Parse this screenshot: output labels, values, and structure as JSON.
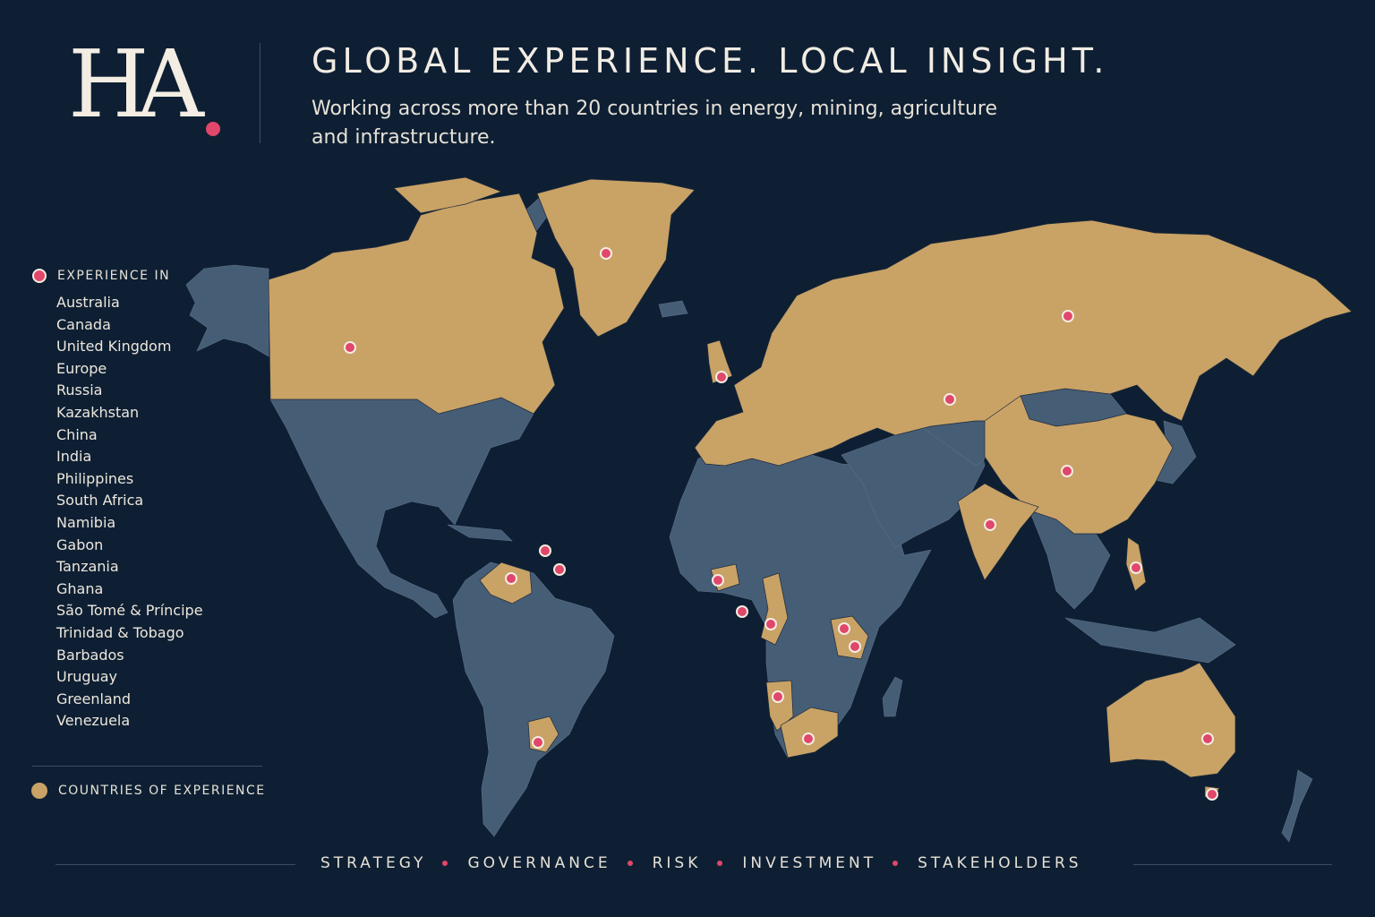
{
  "brand": {
    "logo_text": "HA",
    "accent_color": "#e0476a"
  },
  "header": {
    "title": "GLOBAL EXPERIENCE. LOCAL INSIGHT.",
    "subtitle_line1": "Working across more than 20 countries in energy, mining, agriculture",
    "subtitle_line2": "and infrastructure."
  },
  "legend": {
    "pins_label": "EXPERIENCE IN",
    "countries": [
      "Australia",
      "Canada",
      "United Kingdom",
      "Europe",
      "Russia",
      "Kazakhstan",
      "China",
      "India",
      "Philippines",
      "South Africa",
      "Namibia",
      "Gabon",
      "Tanzania",
      "Ghana",
      "São Tomé & Príncipe",
      "Trinidad & Tobago",
      "Barbados",
      "Uruguay",
      "Greenland",
      "Venezuela"
    ],
    "area_label": "COUNTRIES OF EXPERIENCE"
  },
  "colors": {
    "background": "#0e1f33",
    "experience_land": "#c9a266",
    "other_land": "#465d76",
    "pin": "#e0476a"
  },
  "footer": {
    "items": [
      "STRATEGY",
      "GOVERNANCE",
      "RISK",
      "INVESTMENT",
      "STAKEHOLDERS"
    ]
  }
}
